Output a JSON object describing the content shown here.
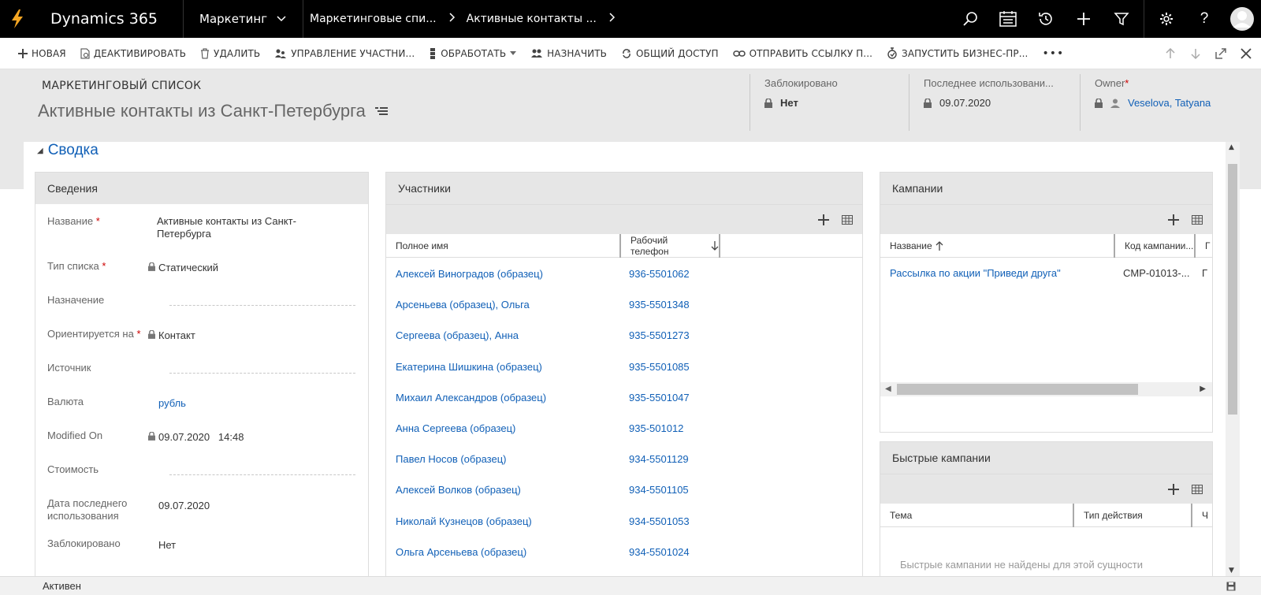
{
  "topnav": {
    "app_name": "Dynamics 365",
    "module": "Маркетинг",
    "breadcrumbs": [
      "Маркетинговые спи...",
      "Активные контакты ..."
    ]
  },
  "commands": [
    {
      "label": "НОВАЯ",
      "icon": "plus-icon"
    },
    {
      "label": "ДЕАКТИВИРОВАТЬ",
      "icon": "deactivate-icon"
    },
    {
      "label": "УДАЛИТЬ",
      "icon": "trash-icon"
    },
    {
      "label": "УПРАВЛЕНИЕ УЧАСТНИ...",
      "icon": "members-icon"
    },
    {
      "label": "ОБРАБОТАТЬ",
      "icon": "process-icon"
    },
    {
      "label": "НАЗНАЧИТЬ",
      "icon": "assign-icon"
    },
    {
      "label": "ОБЩИЙ ДОСТУП",
      "icon": "share-icon"
    },
    {
      "label": "ОТПРАВИТЬ ССЫЛКУ П...",
      "icon": "link-icon"
    },
    {
      "label": "ЗАПУСТИТЬ БИЗНЕС-ПР...",
      "icon": "workflow-icon"
    },
    {
      "label": "•••",
      "icon": "more-icon"
    }
  ],
  "header": {
    "entity_type": "МАРКЕТИНГОВЫЙ СПИСОК",
    "title": "Активные контакты из Санкт-Петербурга",
    "locked_label": "Заблокировано",
    "locked_value": "Нет",
    "last_used_label": "Последнее использовани...",
    "last_used_value": "09.07.2020",
    "owner_label": "Owner",
    "owner_value": "Veselova, Tatyana"
  },
  "section": {
    "title": "Сводка"
  },
  "details": {
    "title": "Сведения",
    "name_label": "Название",
    "name_value": "Активные контакты из Санкт-Петербурга",
    "type_label": "Тип списка",
    "type_value": "Статический",
    "purpose_label": "Назначение",
    "target_label": "Ориентируется на",
    "target_value": "Контакт",
    "source_label": "Источник",
    "currency_label": "Валюта",
    "currency_value": "рубль",
    "modified_label": "Modified On",
    "modified_date": "09.07.2020",
    "modified_time": "14:48",
    "cost_label": "Стоимость",
    "last_used_label": "Дата последнего использования",
    "last_used_value": "09.07.2020",
    "locked_label": "Заблокировано",
    "locked_value": "Нет"
  },
  "members": {
    "title": "Участники",
    "col_name": "Полное имя",
    "col_phone": "Рабочий телефон",
    "rows": [
      {
        "name": "Алексей Виноградов (образец)",
        "phone": "936-5501062"
      },
      {
        "name": "Арсеньева (образец), Ольга",
        "phone": "935-5501348"
      },
      {
        "name": "Сергеева (образец), Анна",
        "phone": "935-5501273"
      },
      {
        "name": "Екатерина Шишкина (образец)",
        "phone": "935-5501085"
      },
      {
        "name": "Михаил Александров (образец)",
        "phone": "935-5501047"
      },
      {
        "name": "Анна Сергеева (образец)",
        "phone": "935-501012"
      },
      {
        "name": "Павел Носов (образец)",
        "phone": "934-5501129"
      },
      {
        "name": "Алексей Волков (образец)",
        "phone": "934-5501105"
      },
      {
        "name": "Николай Кузнецов (образец)",
        "phone": "934-5501053"
      },
      {
        "name": "Ольга Арсеньева (образец)",
        "phone": "934-5501024"
      }
    ]
  },
  "campaigns": {
    "title": "Кампании",
    "col_name": "Название",
    "col_code": "Код кампании...",
    "col_extra": "Г",
    "row_name": "Рассылка по акции \"Приведи друга\"",
    "row_code": "CMP-01013-...",
    "row_extra": "Г"
  },
  "quick": {
    "title": "Быстрые кампании",
    "col_subject": "Тема",
    "col_type": "Тип действия",
    "col_extra": "Ч",
    "empty": "Быстрые кампании не найдены для этой сущности"
  },
  "status": {
    "state": "Активен"
  },
  "colors": {
    "accent": "#1160b7",
    "topnav": "#000000",
    "header_band": "#e8e8e8"
  }
}
